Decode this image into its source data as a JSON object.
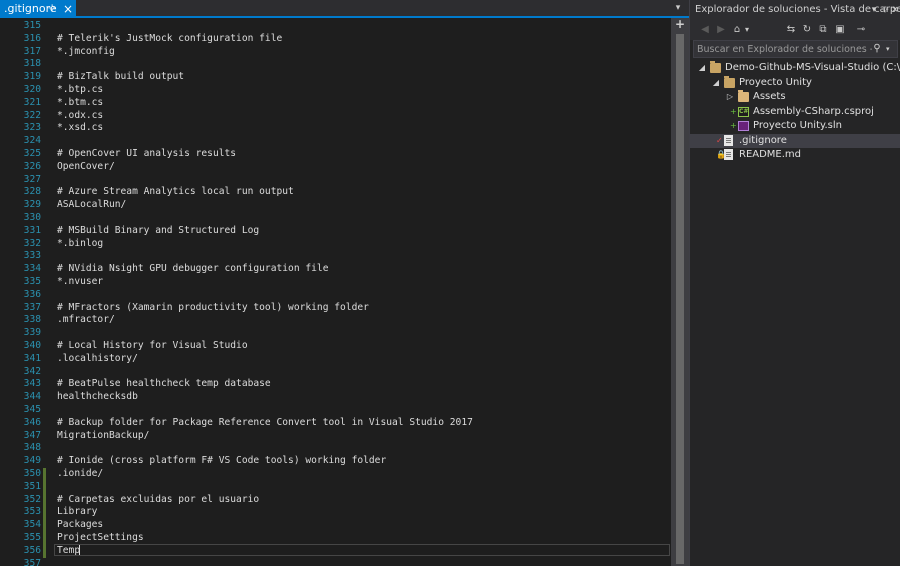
{
  "editor": {
    "tab": {
      "label": ".gitignore",
      "pin_glyph": "⊹",
      "close_glyph": "×"
    },
    "dropdown_glyph": "▾",
    "split_glyph": "+",
    "lines": [
      {
        "n": "315",
        "text": "",
        "changed": false
      },
      {
        "n": "316",
        "text": "# Telerik's JustMock configuration file",
        "changed": false
      },
      {
        "n": "317",
        "text": "*.jmconfig",
        "changed": false
      },
      {
        "n": "318",
        "text": "",
        "changed": false
      },
      {
        "n": "319",
        "text": "# BizTalk build output",
        "changed": false
      },
      {
        "n": "320",
        "text": "*.btp.cs",
        "changed": false
      },
      {
        "n": "321",
        "text": "*.btm.cs",
        "changed": false
      },
      {
        "n": "322",
        "text": "*.odx.cs",
        "changed": false
      },
      {
        "n": "323",
        "text": "*.xsd.cs",
        "changed": false
      },
      {
        "n": "324",
        "text": "",
        "changed": false
      },
      {
        "n": "325",
        "text": "# OpenCover UI analysis results",
        "changed": false
      },
      {
        "n": "326",
        "text": "OpenCover/",
        "changed": false
      },
      {
        "n": "327",
        "text": "",
        "changed": false
      },
      {
        "n": "328",
        "text": "# Azure Stream Analytics local run output",
        "changed": false
      },
      {
        "n": "329",
        "text": "ASALocalRun/",
        "changed": false
      },
      {
        "n": "330",
        "text": "",
        "changed": false
      },
      {
        "n": "331",
        "text": "# MSBuild Binary and Structured Log",
        "changed": false
      },
      {
        "n": "332",
        "text": "*.binlog",
        "changed": false
      },
      {
        "n": "333",
        "text": "",
        "changed": false
      },
      {
        "n": "334",
        "text": "# NVidia Nsight GPU debugger configuration file",
        "changed": false
      },
      {
        "n": "335",
        "text": "*.nvuser",
        "changed": false
      },
      {
        "n": "336",
        "text": "",
        "changed": false
      },
      {
        "n": "337",
        "text": "# MFractors (Xamarin productivity tool) working folder",
        "changed": false
      },
      {
        "n": "338",
        "text": ".mfractor/",
        "changed": false
      },
      {
        "n": "339",
        "text": "",
        "changed": false
      },
      {
        "n": "340",
        "text": "# Local History for Visual Studio",
        "changed": false
      },
      {
        "n": "341",
        "text": ".localhistory/",
        "changed": false
      },
      {
        "n": "342",
        "text": "",
        "changed": false
      },
      {
        "n": "343",
        "text": "# BeatPulse healthcheck temp database",
        "changed": false
      },
      {
        "n": "344",
        "text": "healthchecksdb",
        "changed": false
      },
      {
        "n": "345",
        "text": "",
        "changed": false
      },
      {
        "n": "346",
        "text": "# Backup folder for Package Reference Convert tool in Visual Studio 2017",
        "changed": false
      },
      {
        "n": "347",
        "text": "MigrationBackup/",
        "changed": false
      },
      {
        "n": "348",
        "text": "",
        "changed": false
      },
      {
        "n": "349",
        "text": "# Ionide (cross platform F# VS Code tools) working folder",
        "changed": false
      },
      {
        "n": "350",
        "text": ".ionide/",
        "changed": true
      },
      {
        "n": "351",
        "text": "",
        "changed": true
      },
      {
        "n": "352",
        "text": "# Carpetas excluidas por el usuario",
        "changed": true
      },
      {
        "n": "353",
        "text": "Library",
        "changed": true
      },
      {
        "n": "354",
        "text": "Packages",
        "changed": true
      },
      {
        "n": "355",
        "text": "ProjectSettings",
        "changed": true
      },
      {
        "n": "356",
        "text": "Temp",
        "changed": true
      },
      {
        "n": "357",
        "text": "",
        "changed": false
      }
    ]
  },
  "solution_explorer": {
    "title": "Explorador de soluciones - Vista de carpeta",
    "title_buttons": {
      "dropdown": "▾",
      "pin": "⊹",
      "close": "×"
    },
    "toolbar": {
      "back": "◀",
      "forward": "▶",
      "home": "⌂",
      "dd": "▾",
      "switch_views": "⇆",
      "refresh": "↻",
      "collapse": "⧉",
      "show_all": "▣",
      "properties": "⊸"
    },
    "search_placeholder": "Buscar en Explorador de soluciones - Vista de carpeta (Ctrl+`)",
    "search_icon": "⚲",
    "search_dropdown": "▾",
    "tree": [
      {
        "label": "Demo-Github-MS-Visual-Studio (C:\\Users\\",
        "depth": 0,
        "expander": "◢",
        "icon": "folder-open-icon",
        "status": "",
        "status_color": "",
        "selected": false
      },
      {
        "label": "Proyecto Unity",
        "depth": 1,
        "expander": "◢",
        "icon": "folder-open-icon",
        "status": "",
        "status_color": "",
        "selected": false
      },
      {
        "label": "Assets",
        "depth": 2,
        "expander": "▷",
        "icon": "folder-icon",
        "status": "",
        "status_color": "",
        "selected": false
      },
      {
        "label": "Assembly-CSharp.csproj",
        "depth": 2,
        "expander": "",
        "icon": "csproj-icon",
        "status": "+",
        "status_color": "#6abf40",
        "selected": false
      },
      {
        "label": "Proyecto Unity.sln",
        "depth": 2,
        "expander": "",
        "icon": "sln-icon",
        "status": "+",
        "status_color": "#6abf40",
        "selected": false
      },
      {
        "label": ".gitignore",
        "depth": 1,
        "expander": "",
        "icon": "file-icon",
        "status": "✓",
        "status_color": "#e04848",
        "selected": true
      },
      {
        "label": "README.md",
        "depth": 1,
        "expander": "",
        "icon": "file-icon",
        "status": "🔒",
        "status_color": "#7aa6da",
        "selected": false
      }
    ],
    "icon_glyphs": {
      "csproj": "C#"
    }
  }
}
